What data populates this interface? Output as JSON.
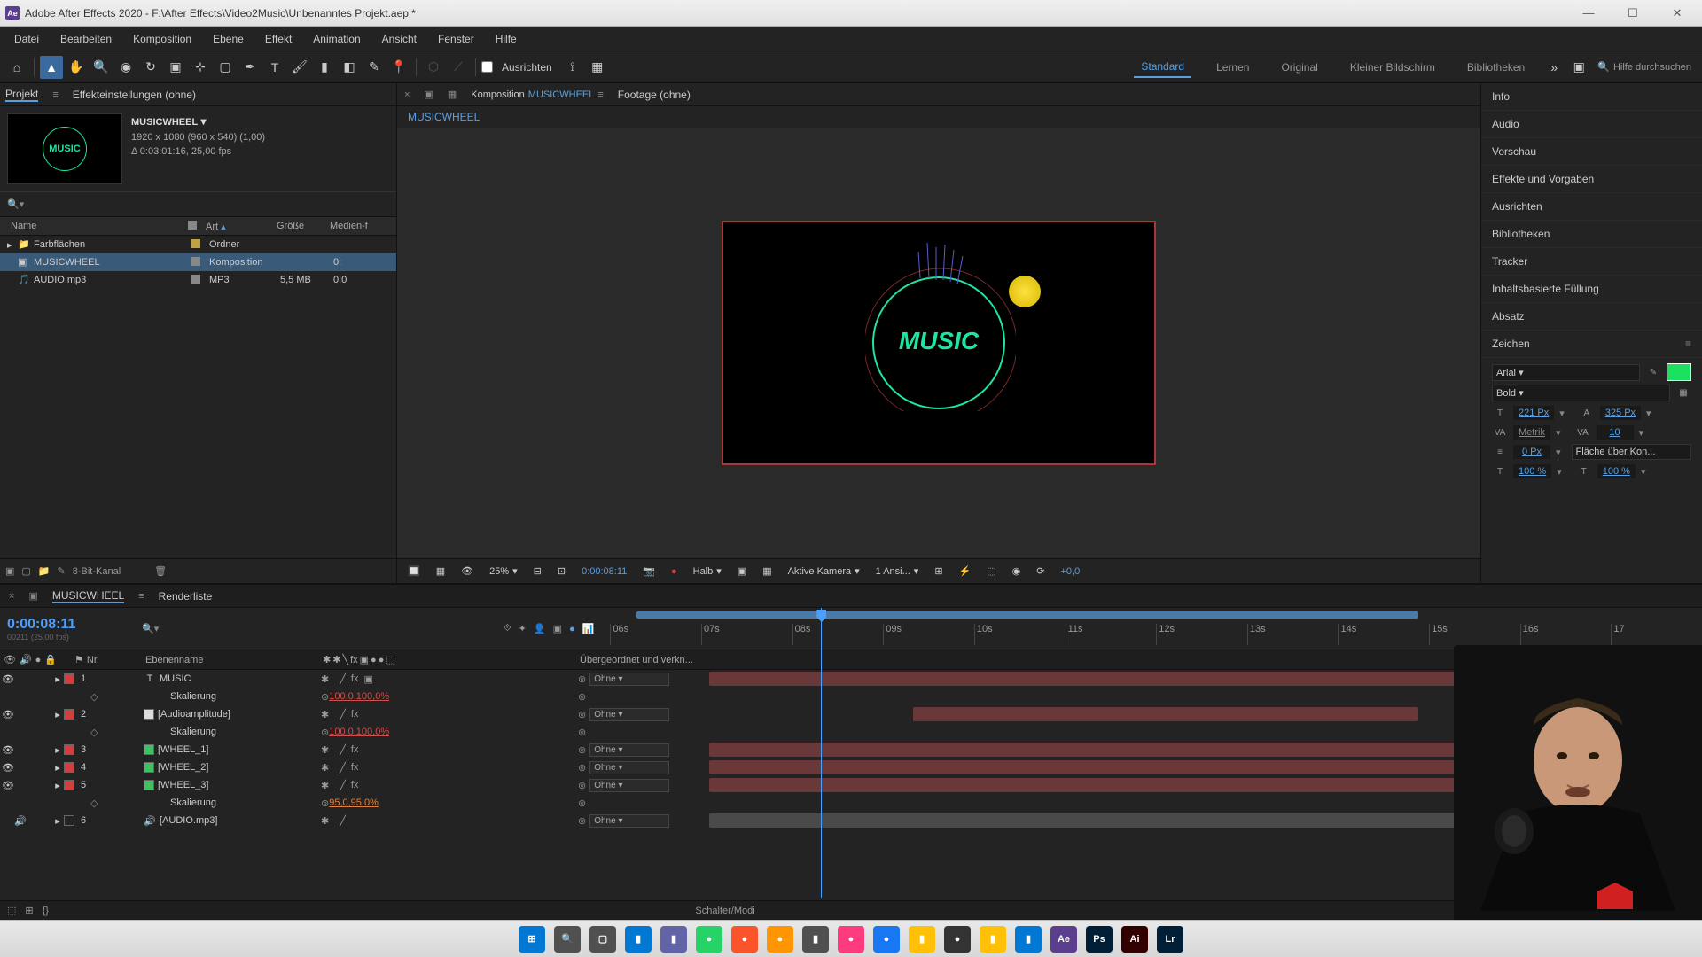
{
  "titlebar": {
    "app_icon": "Ae",
    "title": "Adobe After Effects 2020 - F:\\After Effects\\Video2Music\\Unbenanntes Projekt.aep *"
  },
  "menu": [
    "Datei",
    "Bearbeiten",
    "Komposition",
    "Ebene",
    "Effekt",
    "Animation",
    "Ansicht",
    "Fenster",
    "Hilfe"
  ],
  "toolbar": {
    "align_label": "Ausrichten",
    "workspaces": [
      "Standard",
      "Lernen",
      "Original",
      "Kleiner Bildschirm",
      "Bibliotheken"
    ],
    "active_ws": "Standard",
    "search_placeholder": "Hilfe durchsuchen"
  },
  "project": {
    "tab_project": "Projekt",
    "tab_effects": "Effekteinstellungen (ohne)",
    "comp_name": "MUSICWHEEL",
    "comp_res": "1920 x 1080 (960 x 540) (1,00)",
    "comp_dur": "Δ 0:03:01:16, 25,00 fps",
    "col_name": "Name",
    "col_art": "Art",
    "col_size": "Größe",
    "col_media": "Medien-f",
    "rows": [
      {
        "name": "Farbflächen",
        "art": "Ordner",
        "size": "",
        "extra": ""
      },
      {
        "name": "MUSICWHEEL",
        "art": "Komposition",
        "size": "",
        "extra": "0:"
      },
      {
        "name": "AUDIO.mp3",
        "art": "MP3",
        "size": "5,5 MB",
        "extra": "0:0"
      }
    ],
    "footer_bit": "8-Bit-Kanal"
  },
  "composition": {
    "tab_prefix": "Komposition",
    "comp_name": "MUSICWHEEL",
    "footage_tab": "Footage (ohne)",
    "breadcrumb": "MUSICWHEEL",
    "preview_text": "MUSIC",
    "footer": {
      "zoom": "25%",
      "time": "0:00:08:11",
      "res": "Halb",
      "camera": "Aktive Kamera",
      "views": "1 Ansi...",
      "exposure": "+0,0"
    }
  },
  "right": {
    "panels": [
      "Info",
      "Audio",
      "Vorschau",
      "Effekte und Vorgaben",
      "Ausrichten",
      "Bibliotheken",
      "Tracker",
      "Inhaltsbasierte Füllung",
      "Absatz"
    ],
    "zeichen": "Zeichen",
    "font": "Arial",
    "weight": "Bold",
    "size": "221 Px",
    "leading": "325 Px",
    "kerning": "Metrik",
    "tracking": "10",
    "baseline": "0 Px",
    "fill_label": "Fläche über Kon...",
    "scale_h": "100 %",
    "scale_v": "100 %"
  },
  "timeline": {
    "tab_comp": "MUSICWHEEL",
    "tab_render": "Renderliste",
    "timecode": "0:00:08:11",
    "framecode": "00211 (25.00 fps)",
    "col_nr": "Nr.",
    "col_name": "Ebenenname",
    "col_parent": "Übergeordnet und verkn...",
    "parent_none": "Ohne",
    "ruler": [
      "06s",
      "07s",
      "08s",
      "09s",
      "10s",
      "11s",
      "12s",
      "13s",
      "14s",
      "15s",
      "16s",
      "17"
    ],
    "layers": [
      {
        "nr": "1",
        "color": "red",
        "type": "T",
        "name": "MUSIC",
        "skalierung": "100,0,100,0%"
      },
      {
        "nr": "2",
        "color": "red",
        "type": "solid",
        "name": "[Audioamplitude]",
        "skalierung": "100,0,100,0%"
      },
      {
        "nr": "3",
        "color": "red",
        "type": "solid-g",
        "name": "[WHEEL_1]"
      },
      {
        "nr": "4",
        "color": "red",
        "type": "solid-g",
        "name": "[WHEEL_2]"
      },
      {
        "nr": "5",
        "color": "red",
        "type": "solid-g",
        "name": "[WHEEL_3]",
        "skalierung": "95,0,95,0%"
      },
      {
        "nr": "6",
        "color": "gray",
        "type": "audio",
        "name": "[AUDIO.mp3]"
      }
    ],
    "skalierung_label": "Skalierung",
    "footer": "Schalter/Modi"
  },
  "taskbar": {
    "icons": [
      {
        "name": "windows",
        "c": "#0078d4",
        "t": "⊞"
      },
      {
        "name": "search",
        "c": "#505050",
        "t": "🔍"
      },
      {
        "name": "taskview",
        "c": "#505050",
        "t": "▢"
      },
      {
        "name": "explorer",
        "c": "#0078d4",
        "t": "▮"
      },
      {
        "name": "teams",
        "c": "#6264a7",
        "t": "▮"
      },
      {
        "name": "whatsapp",
        "c": "#25d366",
        "t": "●"
      },
      {
        "name": "brave",
        "c": "#fb542b",
        "t": "●"
      },
      {
        "name": "firefox",
        "c": "#ff9500",
        "t": "●"
      },
      {
        "name": "app1",
        "c": "#505050",
        "t": "▮"
      },
      {
        "name": "messenger",
        "c": "#ff3b7f",
        "t": "●"
      },
      {
        "name": "facebook",
        "c": "#1877f2",
        "t": "●"
      },
      {
        "name": "notes",
        "c": "#ffc107",
        "t": "▮"
      },
      {
        "name": "obs",
        "c": "#333333",
        "t": "●"
      },
      {
        "name": "files",
        "c": "#ffc107",
        "t": "▮"
      },
      {
        "name": "notepad",
        "c": "#0078d4",
        "t": "▮"
      },
      {
        "name": "aftereffects",
        "c": "#5b3e8e",
        "t": "Ae"
      },
      {
        "name": "photoshop",
        "c": "#001e36",
        "t": "Ps"
      },
      {
        "name": "illustrator",
        "c": "#330000",
        "t": "Ai"
      },
      {
        "name": "lightroom",
        "c": "#001e36",
        "t": "Lr"
      }
    ]
  }
}
